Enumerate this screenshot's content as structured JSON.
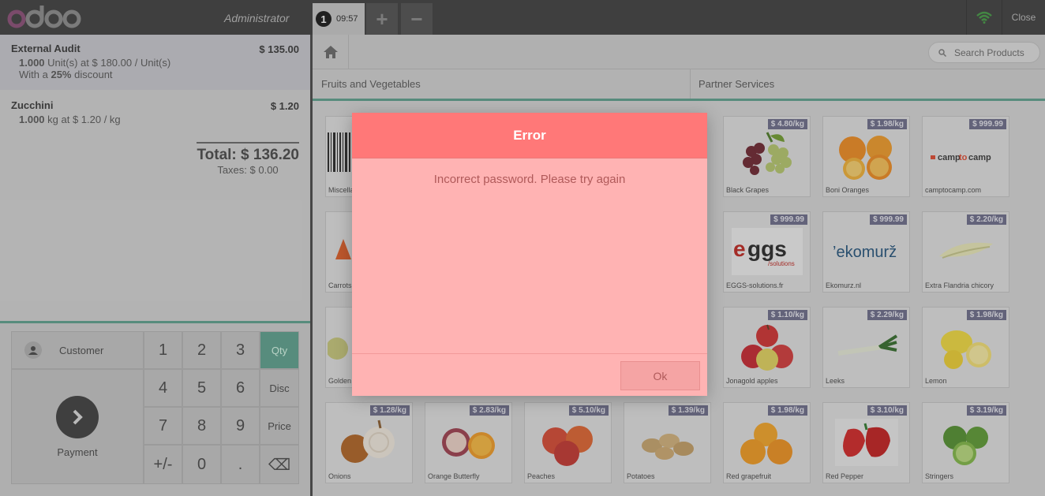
{
  "header": {
    "user_name": "Administrator",
    "order_number": "1",
    "order_time": "09:57",
    "add_order_label": "+",
    "remove_order_label": "−",
    "close_label": "Close"
  },
  "orderlines": [
    {
      "name": "External Audit",
      "price": "$ 135.00",
      "qty": "1.000",
      "info": " Unit(s) at $ 180.00 / Unit(s)",
      "disc_prefix": "With a ",
      "disc_value": "25%",
      "disc_suffix": " discount"
    },
    {
      "name": "Zucchini",
      "price": "$ 1.20",
      "qty": "1.000",
      "info": " kg at $ 1.20 / kg"
    }
  ],
  "summary": {
    "total": "Total: $ 136.20",
    "taxes": "Taxes: $ 0.00"
  },
  "actionpad": {
    "customer_label": "Customer",
    "payment_label": "Payment"
  },
  "numpad": {
    "keys": [
      "1",
      "2",
      "3",
      "Qty",
      "4",
      "5",
      "6",
      "Disc",
      "7",
      "8",
      "9",
      "Price",
      "+/-",
      "0",
      ".",
      "⌫"
    ],
    "active_mode": "Qty"
  },
  "search": {
    "placeholder": "Search Products"
  },
  "categories": [
    "Fruits and Vegetables",
    "Partner Services"
  ],
  "products": [
    {
      "name": "Miscellaneous",
      "price": "",
      "icon": "barcode-icon"
    },
    {
      "name": "Black Grapes",
      "price": "$ 4.80/kg",
      "icon": "grapes-icon"
    },
    {
      "name": "Boni Oranges",
      "price": "$ 1.98/kg",
      "icon": "oranges-icon"
    },
    {
      "name": "camptocamp.com",
      "price": "$ 999.99",
      "icon": "camptocamp-logo"
    },
    {
      "name": "Carrots",
      "price": "",
      "icon": "carrots-icon"
    },
    {
      "name": "EGGS-solutions.fr",
      "price": "$ 999.99",
      "icon": "eggs-logo"
    },
    {
      "name": "Ekomurz.nl",
      "price": "$ 999.99",
      "icon": "ekomurz-logo"
    },
    {
      "name": "Extra Flandria chicory",
      "price": "$ 2.20/kg",
      "icon": "chicory-icon"
    },
    {
      "name": "Golden",
      "price": "",
      "icon": "apple-icon"
    },
    {
      "name": "Jonagold apples",
      "price": "$ 1.10/kg",
      "icon": "apples-icon"
    },
    {
      "name": "Leeks",
      "price": "$ 2.29/kg",
      "icon": "leek-icon"
    },
    {
      "name": "Lemon",
      "price": "$ 1.98/kg",
      "icon": "lemon-icon"
    },
    {
      "name": "Onions",
      "price": "$ 1.28/kg",
      "icon": "onions-icon"
    },
    {
      "name": "Orange Butterfly",
      "price": "$ 2.83/kg",
      "icon": "orange-butterfly-icon"
    },
    {
      "name": "Peaches",
      "price": "$ 5.10/kg",
      "icon": "peaches-icon"
    },
    {
      "name": "Potatoes",
      "price": "$ 1.39/kg",
      "icon": "potatoes-icon"
    },
    {
      "name": "Red grapefruit",
      "price": "$ 1.98/kg",
      "icon": "grapefruit-icon"
    },
    {
      "name": "Red Pepper",
      "price": "$ 3.10/kg",
      "icon": "pepper-icon"
    },
    {
      "name": "Stringers",
      "price": "$ 3.19/kg",
      "icon": "limes-icon"
    }
  ],
  "dialog": {
    "title": "Error",
    "message": "Incorrect password. Please try again",
    "ok_label": "Ok"
  },
  "colors": {
    "accent": "#5aa08c",
    "dialog_header": "#ff7878",
    "dialog_body": "#ffb3b3",
    "brand_logo": "#875a7b"
  }
}
